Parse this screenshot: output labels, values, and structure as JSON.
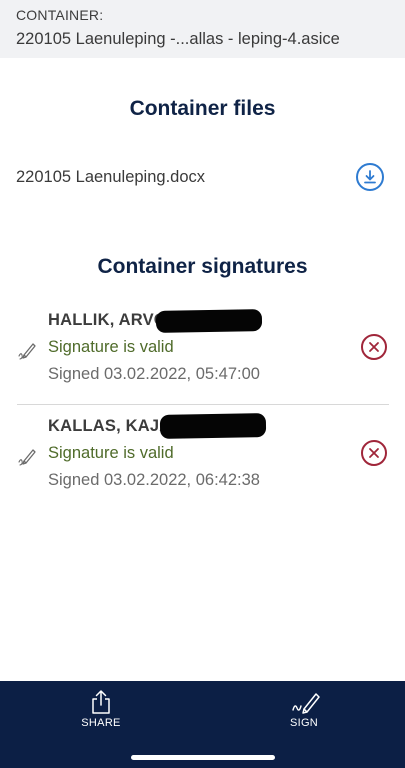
{
  "header": {
    "label": "CONTAINER:",
    "name": "220105 Laenuleping -...allas - leping-4.asice"
  },
  "files_section": {
    "title": "Container files",
    "files": [
      {
        "name": "220105 Laenuleping.docx"
      }
    ]
  },
  "signatures_section": {
    "title": "Container signatures",
    "signatures": [
      {
        "name": "HALLIK, ARVO,",
        "status": "Signature is valid",
        "signed": "Signed 03.02.2022, 05:47:00"
      },
      {
        "name": "KALLAS, KAJA,",
        "status": "Signature is valid",
        "signed": "Signed 03.02.2022, 06:42:38"
      }
    ]
  },
  "bottom_bar": {
    "share_label": "SHARE",
    "sign_label": "SIGN"
  },
  "colors": {
    "navy": "#0c1f45",
    "title": "#0f2346",
    "valid": "#4f6b2a",
    "remove": "#a0263a",
    "download": "#2e7bd1"
  }
}
